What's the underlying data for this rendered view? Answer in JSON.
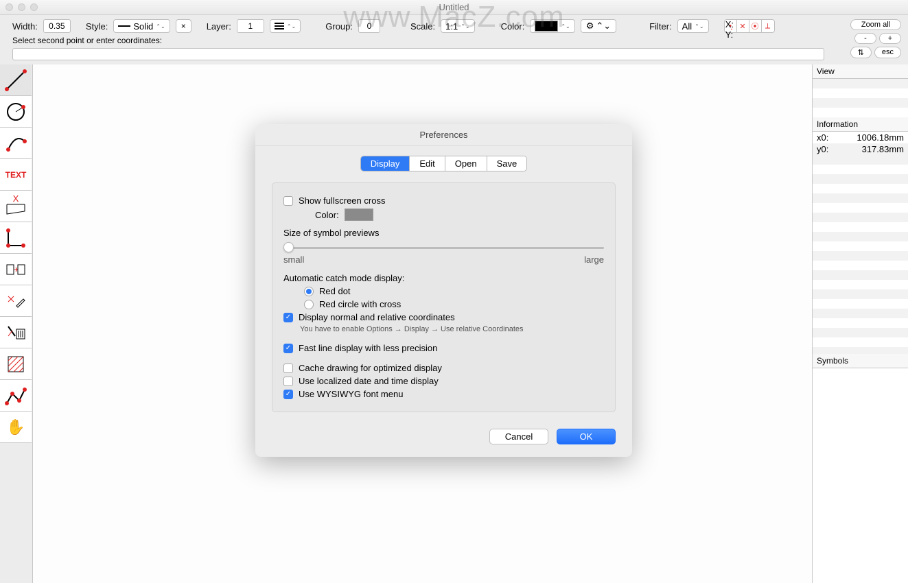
{
  "window": {
    "title": "Untitled"
  },
  "watermark": "www.MacZ.com",
  "toolbar": {
    "width_label": "Width:",
    "width_value": "0.35",
    "style_label": "Style:",
    "style_value": "Solid",
    "clear_btn": "×",
    "layer_label": "Layer:",
    "layer_value": "1",
    "group_label": "Group:",
    "group_value": "0",
    "scale_label": "Scale:",
    "scale_value": "1:1",
    "color_label": "Color:",
    "filter_label": "Filter:",
    "filter_value": "All",
    "xy_x": "X:",
    "xy_y": "Y:",
    "zoom_all": "Zoom all",
    "zoom_minus": "-",
    "zoom_plus": "+",
    "arrows": "⇅",
    "esc": "esc"
  },
  "prompt": "Select second point or enter coordinates:",
  "tool_icons": [
    "line",
    "circle",
    "arc",
    "text",
    "dimension",
    "corner",
    "transform",
    "annotate",
    "delete",
    "hatch",
    "polyline",
    "hand"
  ],
  "right_panels": {
    "view": "View",
    "info_title": "Information",
    "info": [
      {
        "k": "x0:",
        "v": "1006.18mm"
      },
      {
        "k": "y0:",
        "v": "317.83mm"
      }
    ],
    "symbols": "Symbols"
  },
  "prefs": {
    "title": "Preferences",
    "tabs": [
      "Display",
      "Edit",
      "Open",
      "Save"
    ],
    "active_tab": 0,
    "show_fullscreen_cross": "Show fullscreen cross",
    "color_label": "Color:",
    "size_label": "Size of symbol previews",
    "slider_small": "small",
    "slider_large": "large",
    "catch_label": "Automatic catch mode display:",
    "opt_red_dot": "Red dot",
    "opt_red_circle": "Red circle with cross",
    "display_coords": "Display normal and relative coordinates",
    "display_coords_hint": "You have to enable Options → Display → Use relative Coordinates",
    "fast_line": "Fast line display with less precision",
    "cache_drawing": "Cache drawing for optimized display",
    "localized_date": "Use localized date and time display",
    "wysiwyg_font": "Use WYSIWYG font menu",
    "cancel": "Cancel",
    "ok": "OK",
    "checked": {
      "show_fullscreen_cross": false,
      "display_coords": true,
      "fast_line": true,
      "cache_drawing": false,
      "localized_date": false,
      "wysiwyg_font": true
    },
    "catch_mode": "red_dot"
  }
}
